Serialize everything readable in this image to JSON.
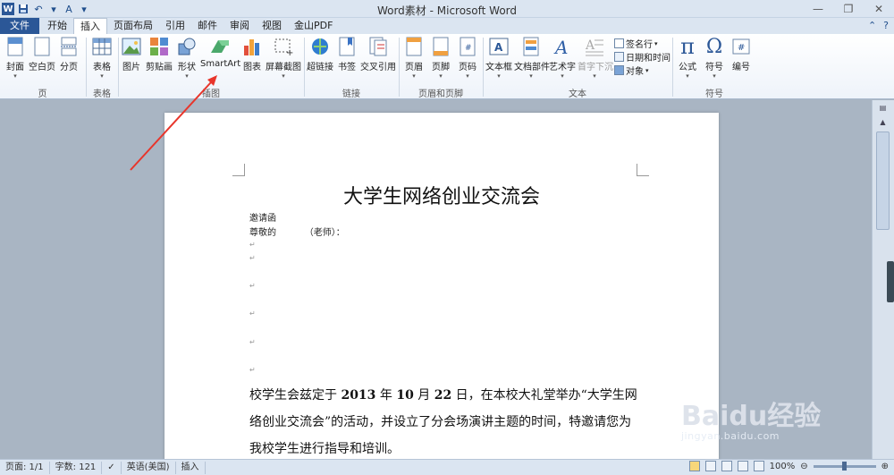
{
  "window": {
    "title": "Word素材 - Microsoft Word"
  },
  "tabs": [
    "开始",
    "插入",
    "页面布局",
    "引用",
    "邮件",
    "审阅",
    "视图",
    "金山PDF"
  ],
  "file_tab": "文件",
  "active_tab": "插入",
  "ribbon": {
    "page": {
      "cover": "封面",
      "blank": "空白页",
      "break": "分页",
      "group": "页"
    },
    "table": {
      "table": "表格",
      "group": "表格"
    },
    "illustrations": {
      "picture": "图片",
      "clipart": "剪贴画",
      "shapes": "形状",
      "smartart": "SmartArt",
      "chart": "图表",
      "screenshot": "屏幕截图",
      "group": "插图"
    },
    "links": {
      "hyperlink": "超链接",
      "bookmark": "书签",
      "crossref": "交叉引用",
      "group": "链接"
    },
    "header_footer": {
      "header": "页眉",
      "footer": "页脚",
      "pagenum": "页码",
      "group": "页眉和页脚"
    },
    "text": {
      "textbox": "文本框",
      "quickparts": "文档部件",
      "wordart": "艺术字",
      "dropcap": "首字下沉",
      "signature": "签名行",
      "datetime": "日期和时间",
      "object": "对象",
      "group": "文本"
    },
    "symbols": {
      "equation": "公式",
      "symbol": "符号",
      "number": "编号",
      "group": "符号"
    }
  },
  "document": {
    "title": "大学生网络创业交流会",
    "line1": "邀请函",
    "line2": "尊敬的          （老师）：",
    "body_part1": "校学生会兹定于 ",
    "body_year": "2013",
    "body_part2": " 年 ",
    "body_month": "10",
    "body_part3": " 月 ",
    "body_day": "22",
    "body_part4": " 日，在本校大礼堂举办“大学生网络创业交流会”的活动，并设立了分会场演讲主题的时间，特邀请您为我校学生进行指导和培训。"
  },
  "statusbar": {
    "page": "页面: 1/1",
    "words": "字数: 121",
    "language": "英语(美国)",
    "mode": "插入",
    "zoom": "100%"
  },
  "watermark": {
    "brand": "Baidu经验",
    "url": "jingyan.baidu.com"
  }
}
